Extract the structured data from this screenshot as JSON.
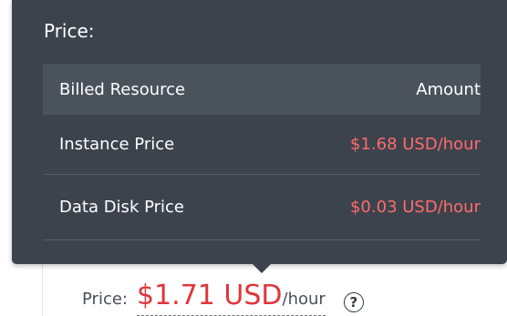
{
  "tooltip": {
    "title": "Price:",
    "table": {
      "headers": [
        "Billed Resource",
        "Amount"
      ],
      "rows": [
        {
          "resource": "Instance Price",
          "amount": "$1.68 USD/hour"
        },
        {
          "resource": "Data Disk Price",
          "amount": "$0.03 USD/hour"
        }
      ]
    }
  },
  "summary": {
    "label": "Price:",
    "value": "$1.71 USD",
    "unit": "/hour",
    "help_icon": "question-circle-icon",
    "help_glyph": "?"
  },
  "colors": {
    "tooltip_bg": "#3c434d",
    "header_bg": "#4a525c",
    "price_red": "#e0353b",
    "amount_red": "#ff6b6b"
  }
}
